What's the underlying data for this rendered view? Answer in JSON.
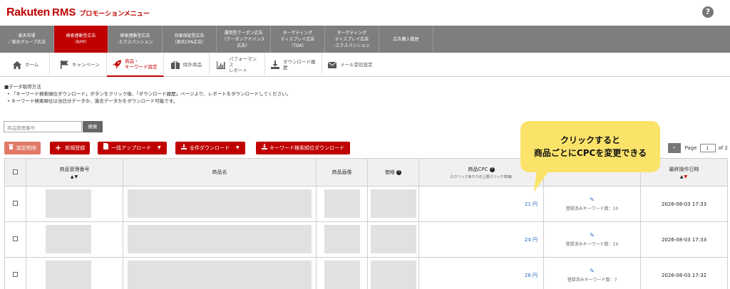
{
  "header": {
    "brand": "Rakuten",
    "rms": "RMS",
    "subtitle": "プロモーションメニュー",
    "help_icon": "?"
  },
  "top_tabs": [
    {
      "label": "楽天市場\n／楽天グループ広告"
    },
    {
      "label": "検索連動型広告\n（RPP）",
      "active": true
    },
    {
      "label": "検索連動型広告\n-エクスパンション"
    },
    {
      "label": "効果保証型広告\n（楽天CPA広告）"
    },
    {
      "label": "運用型クーポン広告\n（クーポンアドバンス\n広告）"
    },
    {
      "label": "ターゲティング\nディスプレイ広告\n（TDA）"
    },
    {
      "label": "ターゲティング\nディスプレイ広告\n-エクスパンション"
    },
    {
      "label": "広告購入履歴"
    }
  ],
  "sub_nav": [
    {
      "label": "ホーム",
      "icon": "home-icon"
    },
    {
      "label": "キャンペーン",
      "icon": "flag-icon"
    },
    {
      "label": "商品・\nキーワード設定",
      "icon": "rocket-icon",
      "active": true
    },
    {
      "label": "除外商品",
      "icon": "exclude-icon"
    },
    {
      "label": "パフォーマンス\nレポート",
      "icon": "chart-icon"
    },
    {
      "label": "ダウンロード履歴",
      "icon": "download-icon"
    },
    {
      "label": "メール受信設定",
      "icon": "mail-icon"
    }
  ],
  "notes": {
    "heading": "■データ取得方法",
    "items": [
      "「キーワード検索順位ダウンロード」ボタンをクリック後、「ダウンロード履歴」ページより、レポートをダウンロードしてください。",
      "キーワード検索順位は当日分データか、過去データかをダウンロード可能です。"
    ]
  },
  "search": {
    "placeholder": "商品管理番号",
    "button": "検索"
  },
  "actions": {
    "delete_setting": "設定削除",
    "new_register": "新規登録",
    "bulk_upload": "一括アップロード",
    "all_download": "全件ダウンロード",
    "keyword_rank_download": "キーワード検索順位ダウンロード"
  },
  "pager": {
    "next": "»",
    "page_label": "Page",
    "current": "1",
    "of_label": "of 2"
  },
  "table": {
    "headers": {
      "product_code": "商品管理番号",
      "product_name": "商品名",
      "product_image": "商品画像",
      "price": "価格",
      "cpc": "商品CPC",
      "cpc_note": "(1クリックあたりの上限クリック単価)",
      "last_op": "最終操作日時"
    },
    "rows": [
      {
        "cpc": "21 円",
        "keywords": "登録済みキーワード数：10",
        "date": "2026-08-03 17:33"
      },
      {
        "cpc": "24 円",
        "keywords": "登録済みキーワード数：10",
        "date": "2026-08-03 17:33"
      },
      {
        "cpc": "26 円",
        "keywords": "登録済みキーワード数：7",
        "date": "2026-08-03 17:32"
      }
    ]
  },
  "bubble": {
    "line1": "クリックすると",
    "line2": "商品ごとにCPCを変更できる"
  },
  "colors": {
    "brand_red": "#bf0000",
    "tab_grey": "#7e7e7e",
    "bubble_yellow": "#fbe36a",
    "link_blue": "#2a6cc0"
  }
}
